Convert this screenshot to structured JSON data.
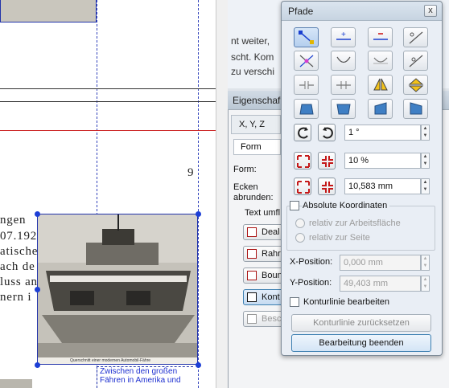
{
  "background_text": {
    "line1": "nt weiter, ",
    "line2": "scht. Kom",
    "line3": "zu verschi"
  },
  "document": {
    "page_number": "9",
    "lines": [
      "ngen",
      "07.192",
      "atische",
      "ach de",
      "luss an",
      "nern i"
    ],
    "caption": [
      "Zwischen den großen",
      "Fähren in Amerika und"
    ],
    "photo_caption": "Querschnitt einer modernen Automobil-Fähre"
  },
  "properties_panel": {
    "title": "Eigenschaf",
    "xyz_label": "X, Y, Z",
    "tab_form": "Form",
    "form_label": "Form:",
    "corners_label": "Ecken abrunden:",
    "corners_label_line1": "Ecken",
    "corners_label_line2": "abrunden:",
    "text_flow_label": "Text umfl",
    "buttons": [
      "Deal",
      "Rahr",
      "Boun",
      "Kont",
      "Besc"
    ]
  },
  "paths_window": {
    "title": "Pfade",
    "close_label": "x",
    "rotation_value": "1 °",
    "scale_value": "10 %",
    "resize_value": "10,583 mm",
    "absolute_coords_label": "Absolute Koordinaten",
    "relative_page_area": "relativ zur Arbeitsfläche",
    "relative_page": "relativ zur Seite",
    "x_position_label": "X-Position:",
    "x_position_value": "0,000 mm",
    "y_position_label": "Y-Position:",
    "y_position_value": "49,403 mm",
    "edit_contour_label": "Konturlinie bearbeiten",
    "reset_contour_label": "Konturlinie zurücksetzen",
    "finish_editing_label": "Bearbeitung beenden"
  },
  "colors": {
    "accent": "#1d3fd6",
    "guide_red": "#cc2222"
  }
}
